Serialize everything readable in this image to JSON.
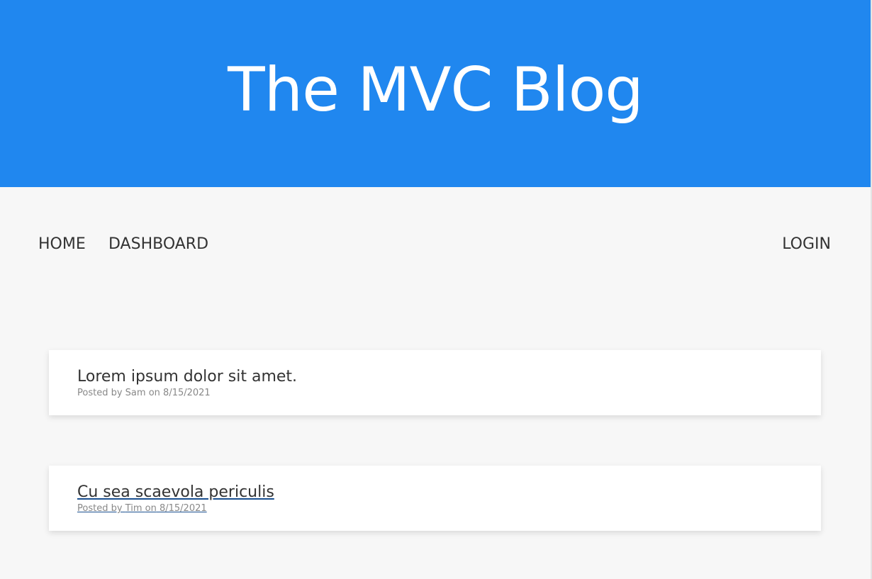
{
  "header": {
    "title": "The MVC Blog",
    "bg_color": "#2087ef"
  },
  "nav": {
    "home": "HOME",
    "dashboard": "DASHBOARD",
    "login": "LOGIN"
  },
  "posts": [
    {
      "title": "Lorem ipsum dolor sit amet.",
      "posted_by_prefix": "Posted by",
      "author": "Sam",
      "date_prefix": "on",
      "date": "8/15/2021",
      "hovered": false
    },
    {
      "title": "Cu sea scaevola periculis",
      "posted_by_prefix": "Posted by",
      "author": "Tim",
      "date_prefix": "on",
      "date": "8/15/2021",
      "hovered": true
    }
  ]
}
